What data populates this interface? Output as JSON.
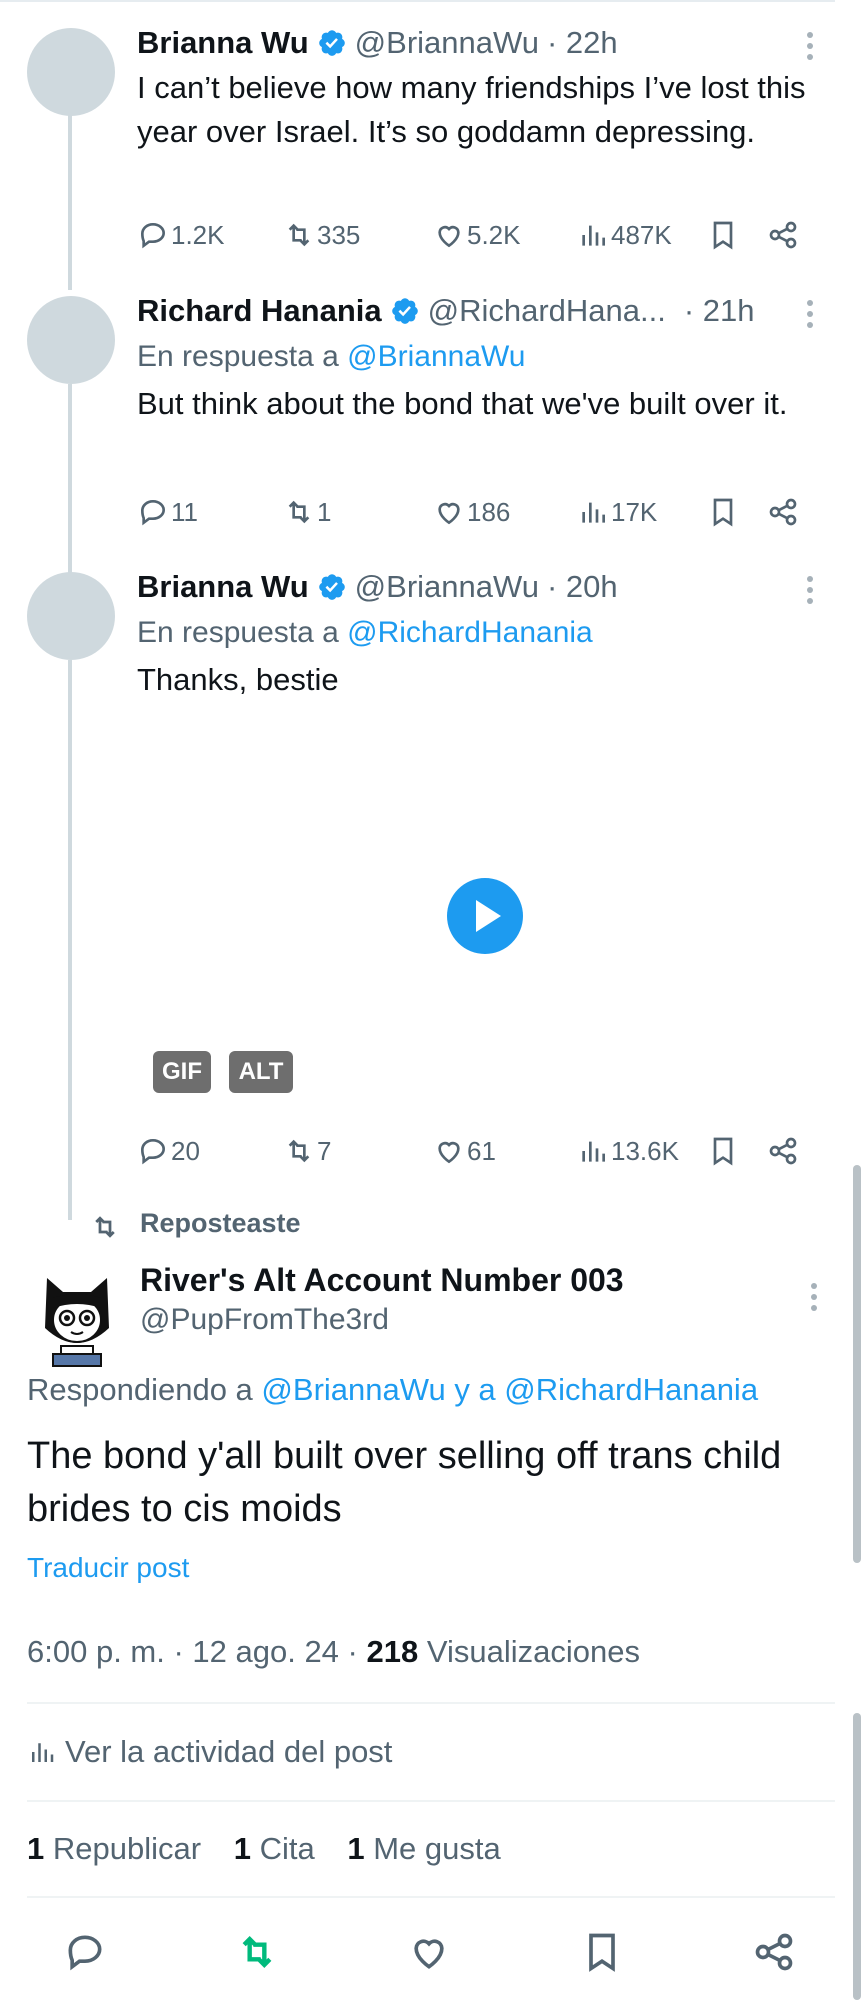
{
  "thread": [
    {
      "name": "Brianna Wu",
      "handle": "@BriannaWu",
      "time": "· 22h",
      "reply_to_label": "",
      "reply_to": "",
      "text": "I can’t believe how many friendships I’ve lost this year over Israel. It’s so goddamn depressing.",
      "stats": {
        "replies": "1.2K",
        "reposts": "335",
        "likes": "5.2K",
        "views": "487K"
      }
    },
    {
      "name": "Richard Hanania",
      "handle": "@RichardHana...",
      "time": "· 21h",
      "reply_to_label": "En respuesta a",
      "reply_to": "@BriannaWu",
      "text": "But think about the bond that we've built over it.",
      "stats": {
        "replies": "11",
        "reposts": "1",
        "likes": "186",
        "views": "17K"
      }
    },
    {
      "name": "Brianna Wu",
      "handle": "@BriannaWu",
      "time": "· 20h",
      "reply_to_label": "En respuesta a",
      "reply_to": "@RichardHanania",
      "text": "Thanks, bestie",
      "media_badges": [
        "GIF",
        "ALT"
      ],
      "stats": {
        "replies": "20",
        "reposts": "7",
        "likes": "61",
        "views": "13.6K"
      }
    }
  ],
  "repost": {
    "label": "Reposteaste",
    "name": "River's Alt Account Number 003",
    "handle": "@PupFromThe3rd",
    "replying_label": "Respondiendo a",
    "reply_user_1": "@BriannaWu",
    "reply_conj": "y a",
    "reply_user_2": "@RichardHanania",
    "text": "The bond y'all built over selling off trans child brides to cis moids",
    "translate": "Traducir post",
    "time": "6:00 p. m. · 12 ago. 24 ·",
    "views_count": "218",
    "views_label": "Visualizaciones",
    "activity": "Ver la actividad del post",
    "reposts_count": "1",
    "reposts_label": "Republicar",
    "quotes_count": "1",
    "quotes_label": "Cita",
    "likes_count": "1",
    "likes_label": "Me gusta"
  },
  "colors": {
    "accent": "#1d9bf0",
    "repost_active": "#00ba7c",
    "muted": "#536471"
  },
  "icons": [
    "reply-icon",
    "repost-icon",
    "like-icon",
    "views-icon",
    "bookmark-icon",
    "share-icon",
    "verified-icon",
    "more-icon",
    "play-icon"
  ]
}
